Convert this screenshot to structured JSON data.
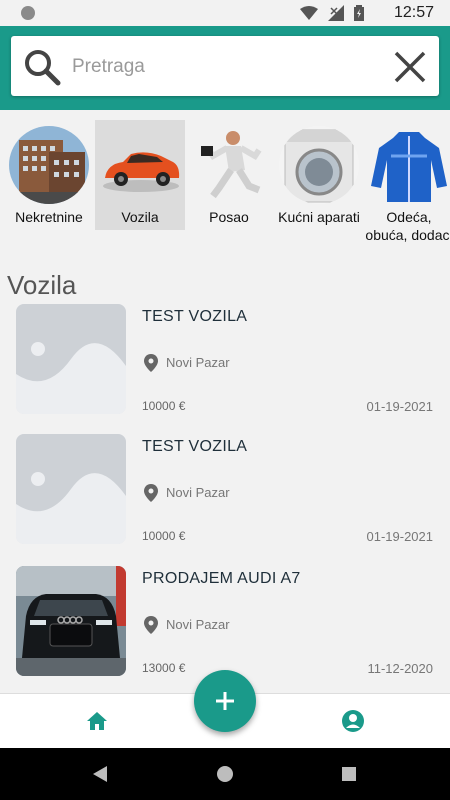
{
  "status_bar": {
    "time": "12:57"
  },
  "search": {
    "placeholder": "Pretraga"
  },
  "categories": [
    {
      "label": "Nekretnine",
      "selected": false
    },
    {
      "label": "Vozila",
      "selected": true
    },
    {
      "label": "Posao",
      "selected": false
    },
    {
      "label": "Kućni aparati",
      "selected": false
    },
    {
      "label": "Odeća, obuća, dodaci",
      "selected": false
    }
  ],
  "section_title": "Vozila",
  "listings": [
    {
      "title": "TEST VOZILA",
      "location": "Novi Pazar",
      "price": "10000 €",
      "date": "01-19-2021",
      "image": "placeholder"
    },
    {
      "title": "TEST VOZILA",
      "location": "Novi Pazar",
      "price": "10000 €",
      "date": "01-19-2021",
      "image": "placeholder"
    },
    {
      "title": "PRODAJEM AUDI A7",
      "location": "Novi Pazar",
      "price": "13000 €",
      "date": "11-12-2020",
      "image": "car-photo"
    }
  ],
  "colors": {
    "accent": "#1a9a8a",
    "background": "#f2f2f2"
  },
  "icons": [
    "search-icon",
    "close-icon",
    "location-pin-icon",
    "home-icon",
    "profile-icon",
    "add-icon"
  ]
}
